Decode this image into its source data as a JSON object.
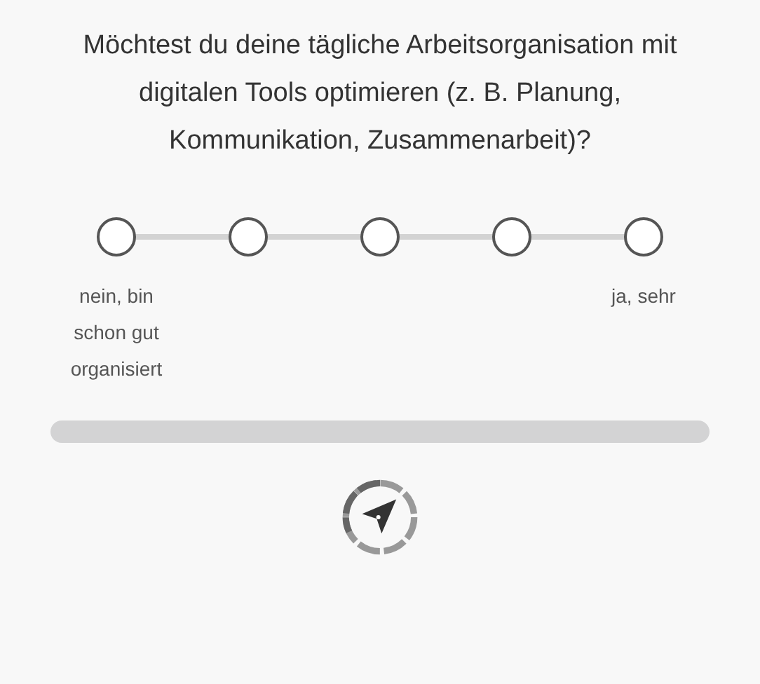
{
  "question": "Möchtest du deine tägliche Arbeitsorganisation mit digitalen Tools optimieren (z. B. Planung, Kommunikation, Zusammenarbeit)?",
  "scale": [
    {
      "selected": false,
      "label": "nein, bin schon gut organisiert"
    },
    {
      "selected": false
    },
    {
      "selected": false
    },
    {
      "selected": false
    },
    {
      "selected": false,
      "label": "ja, sehr"
    }
  ],
  "progress": {
    "level": 0
  }
}
